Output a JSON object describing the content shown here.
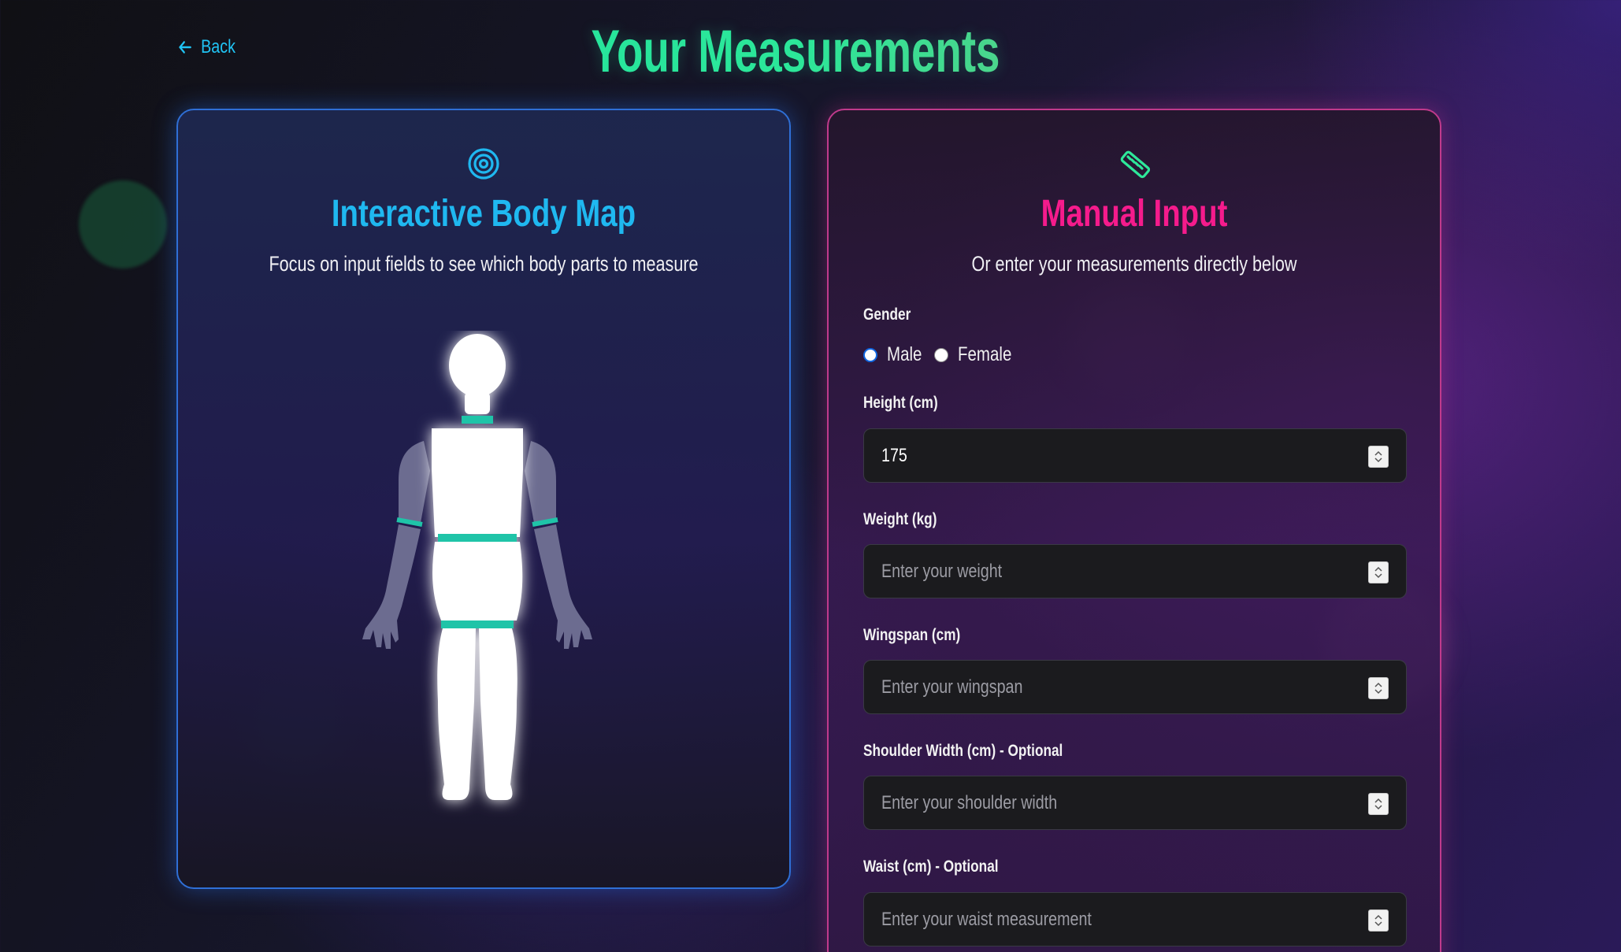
{
  "header": {
    "back_label": "Back",
    "title": "Your Measurements"
  },
  "body_map": {
    "icon": "target-icon",
    "title": "Interactive Body Map",
    "subtitle": "Focus on input fields to see which body parts to measure"
  },
  "manual_input": {
    "icon": "ruler-icon",
    "title": "Manual Input",
    "subtitle": "Or enter your measurements directly below",
    "gender": {
      "label": "Gender",
      "options": [
        "Male",
        "Female"
      ],
      "selected": "Male"
    },
    "fields": [
      {
        "label": "Height (cm)",
        "value": "175",
        "placeholder": ""
      },
      {
        "label": "Weight (kg)",
        "value": "",
        "placeholder": "Enter your weight"
      },
      {
        "label": "Wingspan (cm)",
        "value": "",
        "placeholder": "Enter your wingspan"
      },
      {
        "label": "Shoulder Width (cm) - Optional",
        "value": "",
        "placeholder": "Enter your shoulder width"
      },
      {
        "label": "Waist (cm) - Optional",
        "value": "",
        "placeholder": "Enter your waist measurement"
      }
    ]
  },
  "colors": {
    "accent_cyan": "#1fb8f0",
    "accent_pink": "#f51b8c",
    "accent_green": "#2ee89a",
    "highlight_teal": "#1fc4a8"
  }
}
